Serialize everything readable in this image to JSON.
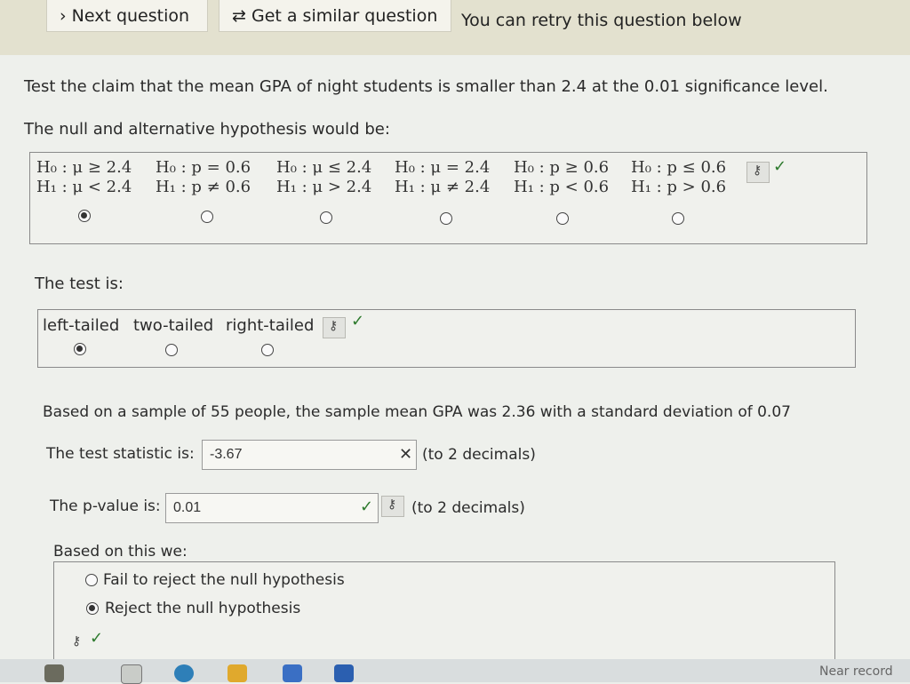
{
  "toolbar": {
    "next_label": "Next question",
    "similar_label": "Get a similar question",
    "retry_text": "You can retry this question below"
  },
  "question": {
    "claim": "Test the claim that the mean GPA of night students is smaller than 2.4 at the 0.01 significance level.",
    "hypothesis_prompt": "The null and alternative hypothesis would be:",
    "hypothesis_options": [
      {
        "h0": "H₀ : μ ≥ 2.4",
        "h1": "H₁ : μ < 2.4",
        "selected": true
      },
      {
        "h0": "H₀ : p = 0.6",
        "h1": "H₁ : p ≠ 0.6",
        "selected": false
      },
      {
        "h0": "H₀ : μ ≤ 2.4",
        "h1": "H₁ : μ > 2.4",
        "selected": false
      },
      {
        "h0": "H₀ : μ = 2.4",
        "h1": "H₁ : μ ≠ 2.4",
        "selected": false
      },
      {
        "h0": "H₀ : p ≥ 0.6",
        "h1": "H₁ : p < 0.6",
        "selected": false
      },
      {
        "h0": "H₀ : p ≤ 0.6",
        "h1": "H₁ : p > 0.6",
        "selected": false
      }
    ],
    "test_prompt": "The test is:",
    "test_options": [
      {
        "label": "left-tailed",
        "selected": true
      },
      {
        "label": "two-tailed",
        "selected": false
      },
      {
        "label": "right-tailed",
        "selected": false
      }
    ],
    "sample_text": "Based on a sample of 55 people, the sample mean GPA was 2.36 with a standard deviation of 0.07",
    "test_stat_label": "The test statistic is:",
    "test_stat_value": "-3.67",
    "test_stat_hint": "(to 2 decimals)",
    "pvalue_label": "The p-value is:",
    "pvalue_value": "0.01",
    "pvalue_hint": "(to 2 decimals)",
    "decision_prompt": "Based on this we:",
    "decision_options": [
      {
        "label": "Fail to reject the null hypothesis",
        "selected": false
      },
      {
        "label": "Reject the null hypothesis",
        "selected": true
      }
    ]
  },
  "icons": {
    "check": "✓",
    "cross": "✕",
    "key": "key-icon"
  },
  "colors": {
    "check": "#2d7a2d",
    "topbar": "#e3e1cf"
  },
  "taskbar": {
    "right_text": "Near record"
  }
}
